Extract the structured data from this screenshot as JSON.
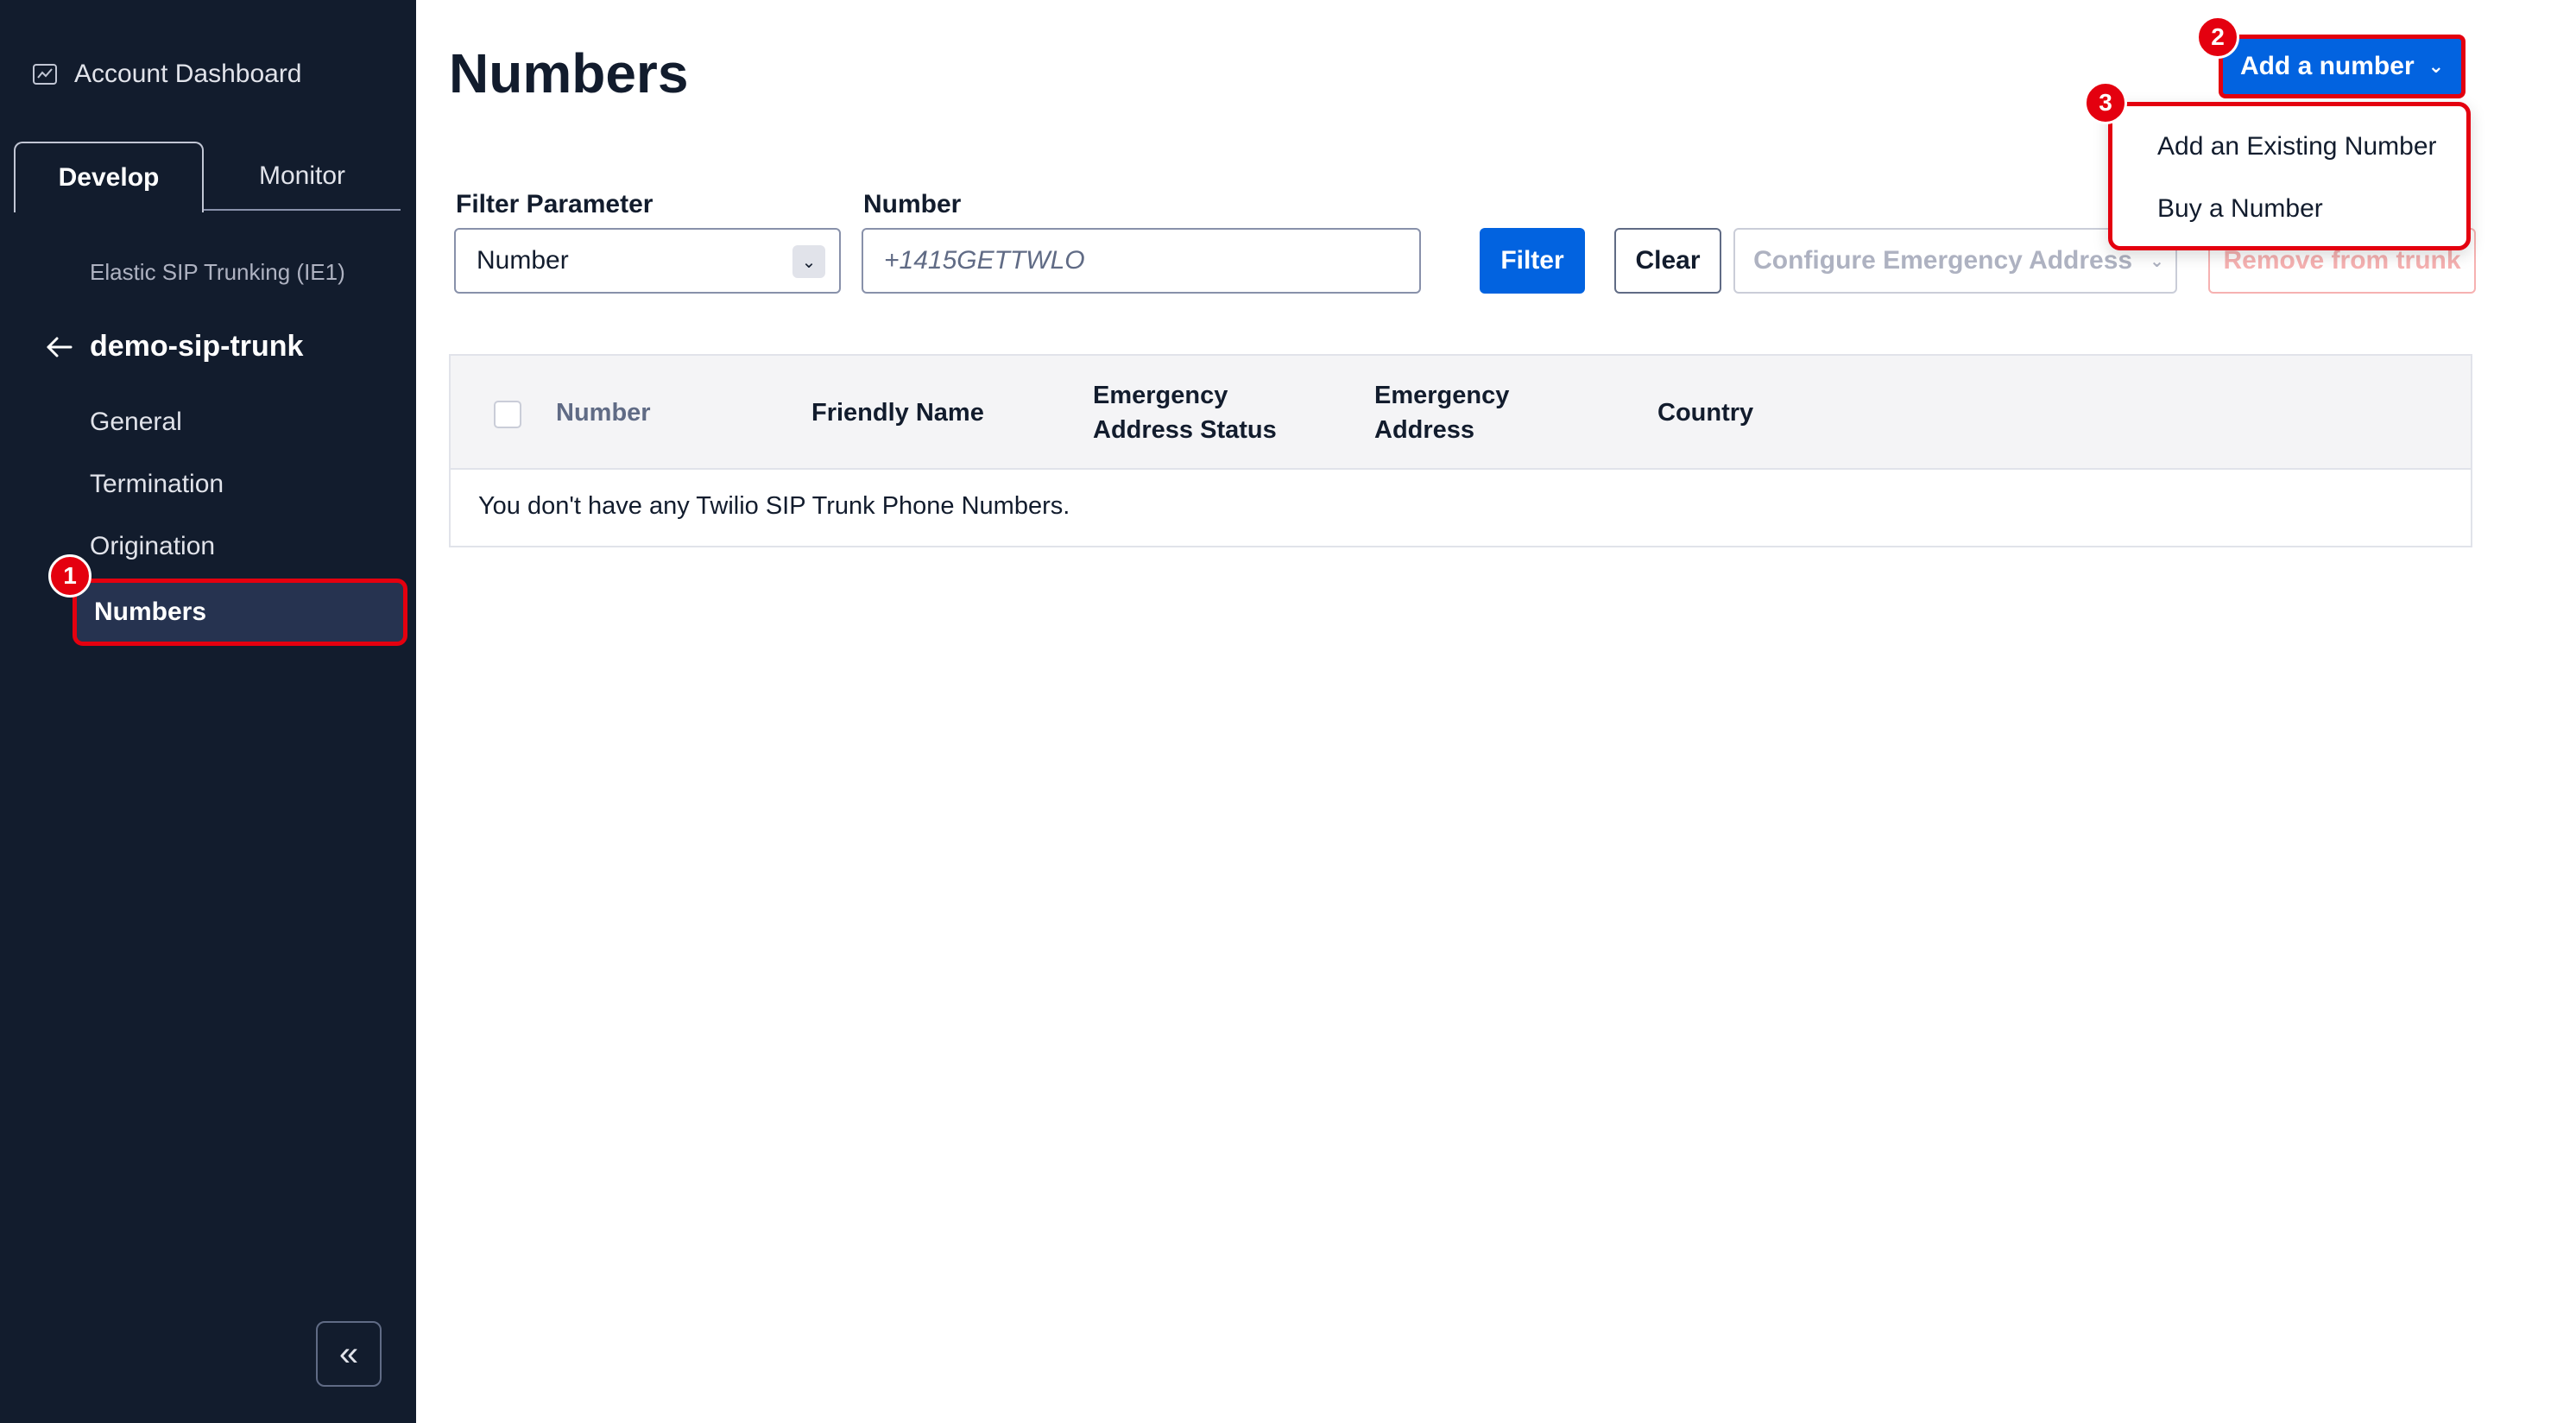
{
  "sidebar": {
    "account_dashboard": "Account Dashboard",
    "tabs": {
      "develop": "Develop",
      "monitor": "Monitor"
    },
    "breadcrumb": "Elastic SIP Trunking (IE1)",
    "trunk_name": "demo-sip-trunk",
    "nav": [
      "General",
      "Termination",
      "Origination",
      "Numbers"
    ],
    "active_nav": "Numbers",
    "collapse": "«"
  },
  "main": {
    "title": "Numbers",
    "add_button": "Add a number",
    "dropdown": [
      "Add an Existing Number",
      "Buy a Number"
    ],
    "filter": {
      "param_label": "Filter Parameter",
      "param_value": "Number",
      "number_label": "Number",
      "number_placeholder": "+1415GETTWLO",
      "filter_button": "Filter",
      "clear_button": "Clear",
      "configure_button": "Configure Emergency Address",
      "remove_button": "Remove from trunk"
    },
    "table": {
      "columns": [
        "Number",
        "Friendly Name",
        "Emergency Address Status",
        "Emergency Address",
        "Country"
      ],
      "empty_message": "You don't have any Twilio SIP Trunk Phone Numbers."
    }
  },
  "annotations": [
    "1",
    "2",
    "3"
  ],
  "colors": {
    "sidebar_bg": "#121c2d",
    "primary": "#0263e0",
    "highlight": "#e4000f"
  }
}
